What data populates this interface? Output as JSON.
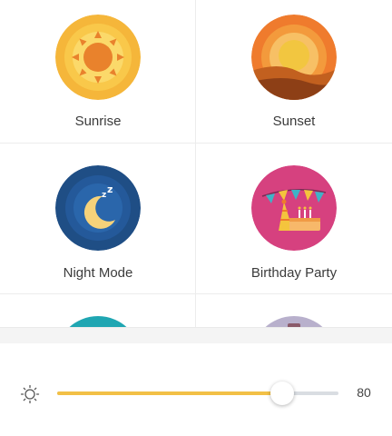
{
  "scenes": [
    {
      "name": "sunrise",
      "label": "Sunrise",
      "icon": "sunrise-icon",
      "color": "#f5b63a"
    },
    {
      "name": "sunset",
      "label": "Sunset",
      "icon": "sunset-icon",
      "color": "#ef7b2d"
    },
    {
      "name": "night-mode",
      "label": "Night Mode",
      "icon": "moon-icon",
      "color": "#1f4e85"
    },
    {
      "name": "birthday-party",
      "label": "Birthday Party",
      "icon": "party-icon",
      "color": "#d6417f"
    },
    {
      "name": "scene-5",
      "label": "",
      "icon": "scene-icon",
      "color": "#1fa6b2"
    },
    {
      "name": "scene-6",
      "label": "",
      "icon": "scene-icon",
      "color": "#b8b0cc"
    }
  ],
  "brightness": {
    "icon": "brightness-icon",
    "value": "80",
    "level_fraction": 0.8,
    "fill_color": "#f2c046",
    "track_color": "#d9dde2"
  }
}
